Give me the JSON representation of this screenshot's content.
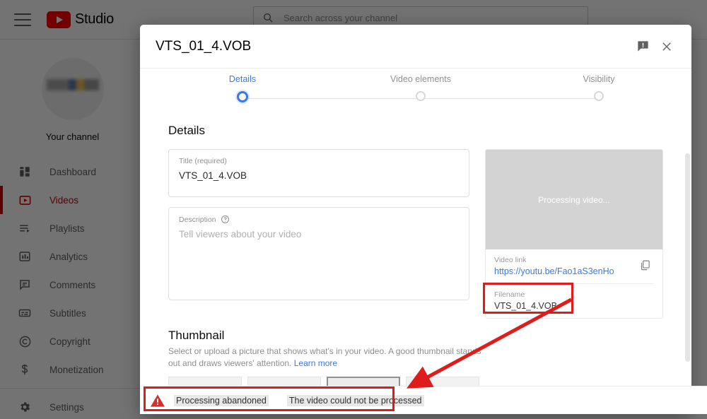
{
  "app": {
    "brand": "Studio",
    "menu_icon": "hamburger-icon",
    "logo_icon": "youtube-logo-icon",
    "search": {
      "placeholder": "Search across your channel",
      "icon": "search-icon"
    },
    "channel": {
      "label": "Your channel"
    },
    "nav": [
      {
        "label": "Dashboard",
        "icon": "dashboard-icon",
        "active": false
      },
      {
        "label": "Videos",
        "icon": "videos-icon",
        "active": true
      },
      {
        "label": "Playlists",
        "icon": "playlists-icon",
        "active": false
      },
      {
        "label": "Analytics",
        "icon": "analytics-icon",
        "active": false
      },
      {
        "label": "Comments",
        "icon": "comments-icon",
        "active": false
      },
      {
        "label": "Subtitles",
        "icon": "subtitles-icon",
        "active": false
      },
      {
        "label": "Copyright",
        "icon": "copyright-icon",
        "active": false
      },
      {
        "label": "Monetization",
        "icon": "monetization-icon",
        "active": false
      },
      {
        "label": "Settings",
        "icon": "settings-gear-icon",
        "active": false
      }
    ]
  },
  "dialog": {
    "title": "VTS_01_4.VOB",
    "feedback_icon": "send-feedback-icon",
    "close_icon": "close-icon",
    "steps": [
      {
        "label": "Details",
        "active": true
      },
      {
        "label": "Video elements",
        "active": false
      },
      {
        "label": "Visibility",
        "active": false
      }
    ],
    "section_title": "Details",
    "title_field": {
      "label": "Title (required)",
      "value": "VTS_01_4.VOB"
    },
    "description_field": {
      "label": "Description",
      "placeholder": "Tell viewers about your video",
      "help_icon": "help-circle-icon"
    },
    "preview": {
      "processing_text": "Processing video...",
      "video_link_label": "Video link",
      "video_link": "https://youtu.be/Fao1aS3enHo",
      "copy_icon": "copy-icon",
      "filename_label": "Filename",
      "filename": "VTS_01_4.VOB"
    },
    "thumbnail": {
      "title": "Thumbnail",
      "description": "Select or upload a picture that shows what's in your video. A good thumbnail stands out and draws viewers' attention.",
      "learn_more": "Learn more",
      "upload_icon": "upload-image-icon",
      "help_icon": "help-circle-icon"
    }
  },
  "error_bar": {
    "warning_icon": "warning-triangle-icon",
    "status": "Processing abandoned",
    "message": "The video could not be processed"
  },
  "annotations": {
    "highlight_color": "#e01b1b",
    "arrow_icon": "annotation-arrow-icon"
  }
}
